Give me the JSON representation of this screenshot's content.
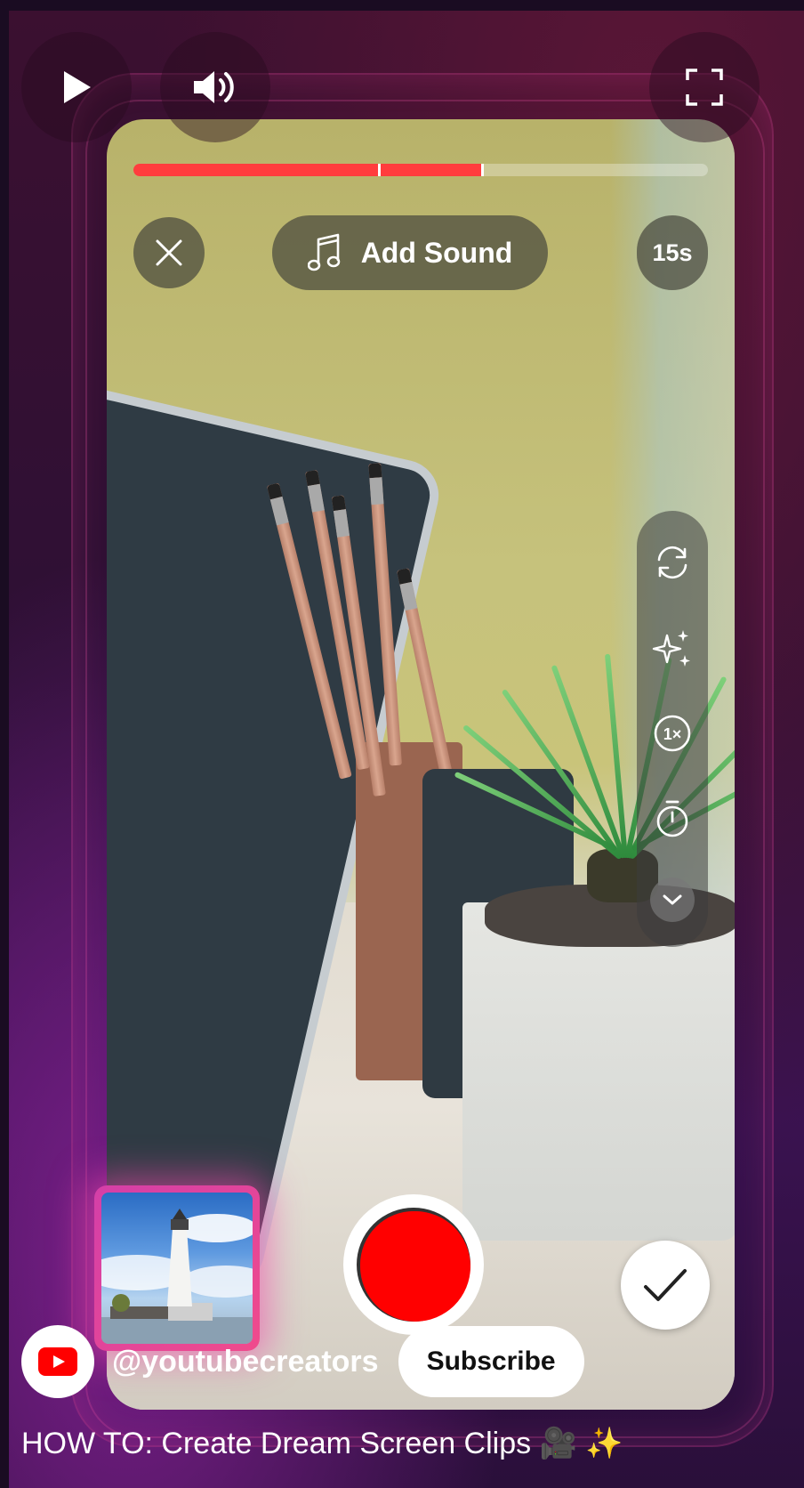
{
  "player_controls": {
    "play_icon": "play-icon",
    "volume_icon": "volume-icon",
    "fullscreen_icon": "fullscreen-icon"
  },
  "camera_ui": {
    "progress": {
      "fill_fraction": 0.605,
      "segment_marks": [
        0.425,
        0.605
      ]
    },
    "close_icon": "close-icon",
    "add_sound_label": "Add Sound",
    "duration_label": "15s",
    "side_tools": [
      "flip-camera-icon",
      "effects-sparkle-icon",
      "speed-1x-icon",
      "timer-icon",
      "chevron-down-icon"
    ],
    "speed_text": "1×",
    "confirm_icon": "checkmark-icon",
    "record_button_color": "#ff0000",
    "accent_color": "#ff3d3d"
  },
  "channel": {
    "handle": "@youtubecreators",
    "subscribe_label": "Subscribe",
    "logo_color": "#ff0000"
  },
  "video": {
    "title": "HOW TO: Create Dream Screen Clips 🎥 ✨"
  }
}
